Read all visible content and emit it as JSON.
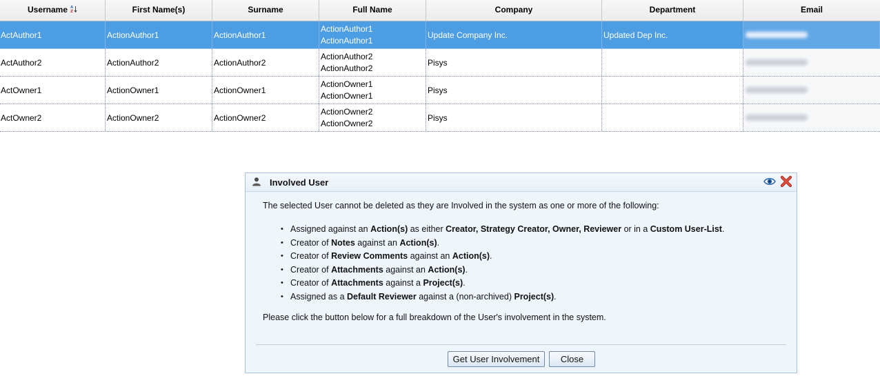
{
  "table": {
    "headers": [
      "Username",
      "First Name(s)",
      "Surname",
      "Full Name",
      "Company",
      "Department",
      "Email"
    ],
    "rows": [
      {
        "username": "ActAuthor1",
        "first": "ActionAuthor1",
        "surname": "ActionAuthor1",
        "full1": "ActionAuthor1",
        "full2": "ActionAuthor1",
        "company": "Update Company Inc.",
        "department": "Updated Dep Inc.",
        "selected": true
      },
      {
        "username": "ActAuthor2",
        "first": "ActionAuthor2",
        "surname": "ActionAuthor2",
        "full1": "ActionAuthor2",
        "full2": "ActionAuthor2",
        "company": "Pisys",
        "department": ""
      },
      {
        "username": "ActOwner1",
        "first": "ActionOwner1",
        "surname": "ActionOwner1",
        "full1": "ActionOwner1",
        "full2": "ActionOwner1",
        "company": "Pisys",
        "department": ""
      },
      {
        "username": "ActOwner2",
        "first": "ActionOwner2",
        "surname": "ActionOwner2",
        "full1": "ActionOwner2",
        "full2": "ActionOwner2",
        "company": "Pisys",
        "department": ""
      }
    ],
    "sort_icon": "sort-az-icon"
  },
  "dialog": {
    "title": "Involved User",
    "title_icon": "user-icon",
    "intro": "The selected User cannot be deleted as they are Involved in the system as one or more of the following:",
    "items": [
      [
        [
          "Assigned against an ",
          false
        ],
        [
          "Action(s)",
          true
        ],
        [
          " as either ",
          false
        ],
        [
          "Creator, Strategy Creator, Owner, Reviewer",
          true
        ],
        [
          " or in a ",
          false
        ],
        [
          "Custom User-List",
          true
        ],
        [
          ".",
          false
        ]
      ],
      [
        [
          "Creator of ",
          false
        ],
        [
          "Notes",
          true
        ],
        [
          " against an ",
          false
        ],
        [
          "Action(s)",
          true
        ],
        [
          ".",
          false
        ]
      ],
      [
        [
          "Creator of ",
          false
        ],
        [
          "Review Comments",
          true
        ],
        [
          " against an ",
          false
        ],
        [
          "Action(s)",
          true
        ],
        [
          ".",
          false
        ]
      ],
      [
        [
          "Creator of ",
          false
        ],
        [
          "Attachments",
          true
        ],
        [
          " against an ",
          false
        ],
        [
          "Action(s)",
          true
        ],
        [
          ".",
          false
        ]
      ],
      [
        [
          "Creator of ",
          false
        ],
        [
          "Attachments",
          true
        ],
        [
          " against a ",
          false
        ],
        [
          "Project(s)",
          true
        ],
        [
          ".",
          false
        ]
      ],
      [
        [
          "Assigned as a ",
          false
        ],
        [
          "Default Reviewer",
          true
        ],
        [
          " against a (non-archived) ",
          false
        ],
        [
          "Project(s)",
          true
        ],
        [
          ".",
          false
        ]
      ]
    ],
    "outro": "Please click the button below for a full breakdown of the User's involvement in the system.",
    "buttons": {
      "involvement": "Get User Involvement",
      "close": "Close"
    },
    "colors": {
      "selected_row": "#4d9de3",
      "dialog_bg": "#eef5fc",
      "close_icon": "#d23a2a",
      "eye_icon": "#1e5fa8"
    }
  }
}
